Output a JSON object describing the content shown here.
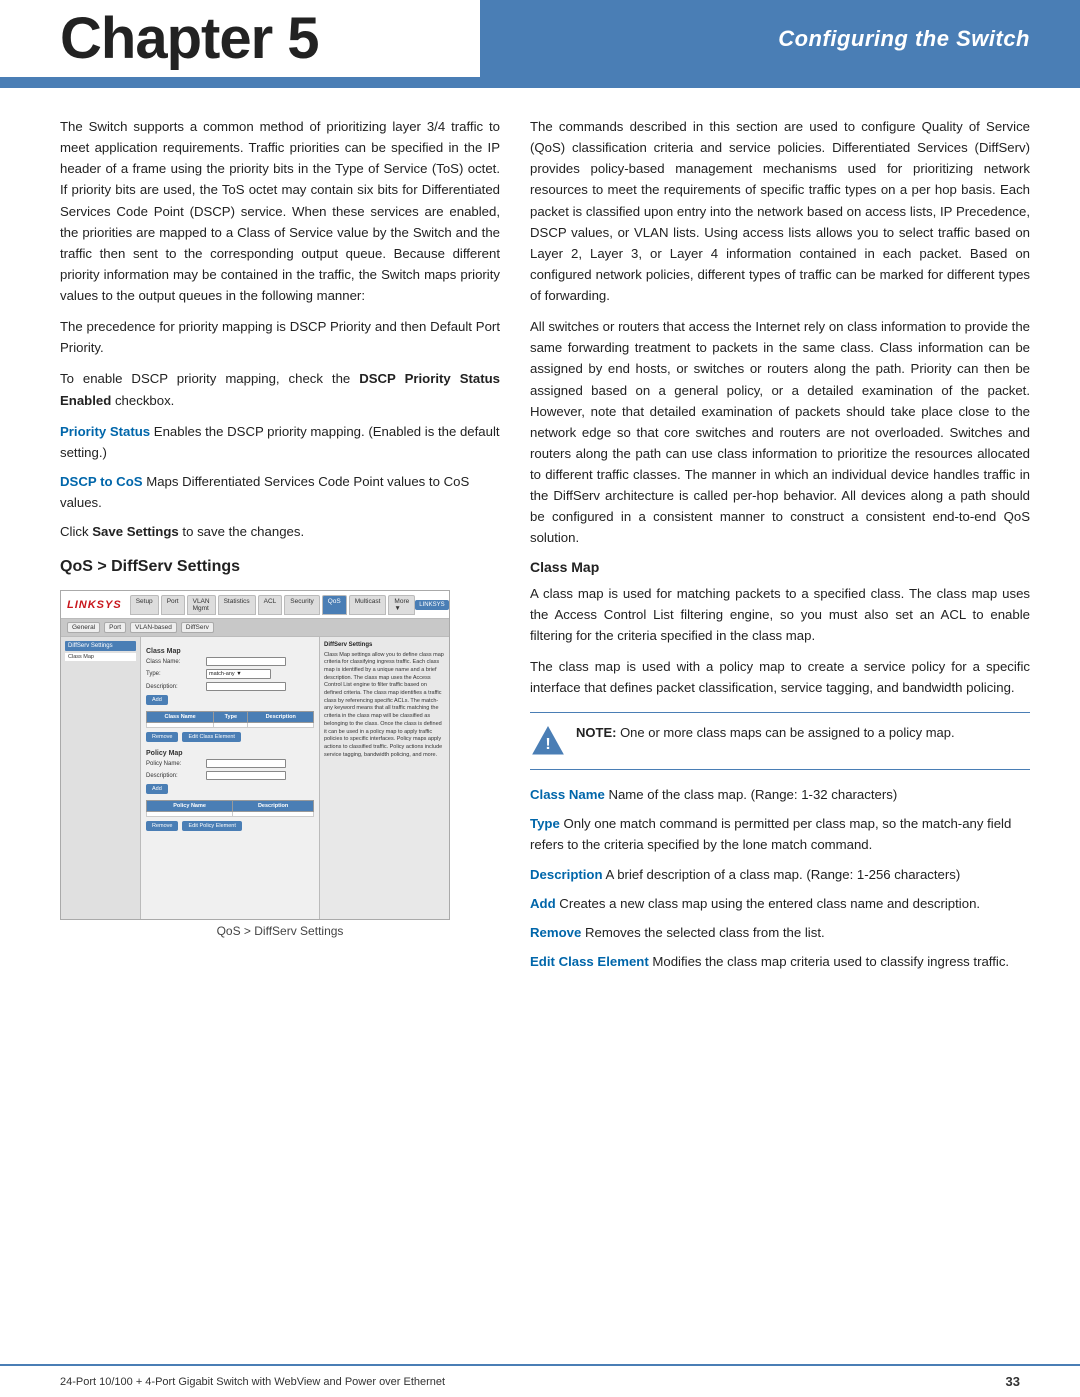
{
  "header": {
    "chapter": "Chapter 5",
    "section": "Configuring the Switch"
  },
  "footer": {
    "left": "24-Port 10/100 + 4-Port Gigabit Switch with WebView and Power over Ethernet",
    "right": "33"
  },
  "left_col": {
    "para1": "The Switch supports a common method of prioritizing layer 3/4 traffic to meet application requirements. Traffic priorities can be specified in the IP header of a frame using the priority bits in the Type of Service (ToS) octet. If priority bits are used, the ToS octet may contain six bits for Differentiated Services Code Point (DSCP) service. When these services are enabled, the priorities are mapped to a Class of Service value by the Switch and the traffic then sent to the corresponding output queue. Because different priority information may be contained in the traffic, the Switch maps priority values to the output queues in the following manner:",
    "para2": "The precedence for priority mapping is DSCP Priority and then Default Port Priority.",
    "para3_pre": "To enable DSCP priority mapping, check the ",
    "para3_bold": "DSCP Priority Status Enabled",
    "para3_post": " checkbox.",
    "term1_label": "Priority Status",
    "term1_text": " Enables the DSCP priority mapping. (Enabled is the default setting.)",
    "term2_label": "DSCP to CoS",
    "term2_text": " Maps Differentiated Services Code Point values to CoS values.",
    "para4_pre": "Click ",
    "para4_bold": "Save Settings",
    "para4_post": " to save the changes.",
    "section_heading": "QoS > DiffServ Settings",
    "caption": "QoS > DiffServ Settings"
  },
  "right_col": {
    "para1": "The commands described in this section are used to configure Quality of Service (QoS) classification criteria and service policies. Differentiated Services (DiffServ) provides policy-based management mechanisms used for prioritizing network resources to meet the requirements of specific traffic types on a per hop basis. Each packet is classified upon entry into the network based on access lists, IP Precedence, DSCP values, or VLAN lists. Using access lists allows you to select traffic based on Layer 2, Layer 3, or Layer 4 information contained in each packet. Based on configured network policies, different types of traffic can be marked for different types of forwarding.",
    "para2": "All switches or routers that access the Internet rely on class information to provide the same forwarding treatment to packets in the same class. Class information can be assigned by end hosts, or switches or routers along the path. Priority can then be assigned based on a general policy, or a detailed examination of the packet. However, note that detailed examination of packets should take place close to the network edge so that core switches and routers are not overloaded. Switches and routers along the path can use class information to prioritize the resources allocated to different traffic classes. The manner in which an individual device handles traffic in the DiffServ architecture is called per-hop behavior. All devices along a path should be configured in a consistent manner to construct a consistent end-to-end QoS solution.",
    "class_map_heading": "Class Map",
    "para3": "A class map is used for matching packets to a specified class. The class map uses the Access Control List filtering engine, so you must also set an ACL to enable filtering for the criteria specified in the class map.",
    "para4": "The class map is used with a policy map to create a service policy for a specific interface that defines packet classification, service tagging, and bandwidth policing.",
    "note_label": "NOTE:",
    "note_text": " One or more class maps can be assigned to a policy map.",
    "term_classname_label": "Class Name",
    "term_classname_text": " Name of the class map. (Range: 1-32 characters)",
    "term_type_label": "Type",
    "term_type_text": " Only one match command is permitted per class map, so the match-any field refers to the criteria specified by the lone match command.",
    "term_desc_label": "Description",
    "term_desc_text": " A brief description of a class map. (Range: 1-256 characters)",
    "term_add_label": "Add",
    "term_add_text": " Creates a new class map using the entered class name and description.",
    "term_remove_label": "Remove",
    "term_remove_text": " Removes the selected class from the list.",
    "term_edit_label": "Edit Class Element",
    "term_edit_text": " Modifies the class map criteria used to classify ingress traffic."
  }
}
